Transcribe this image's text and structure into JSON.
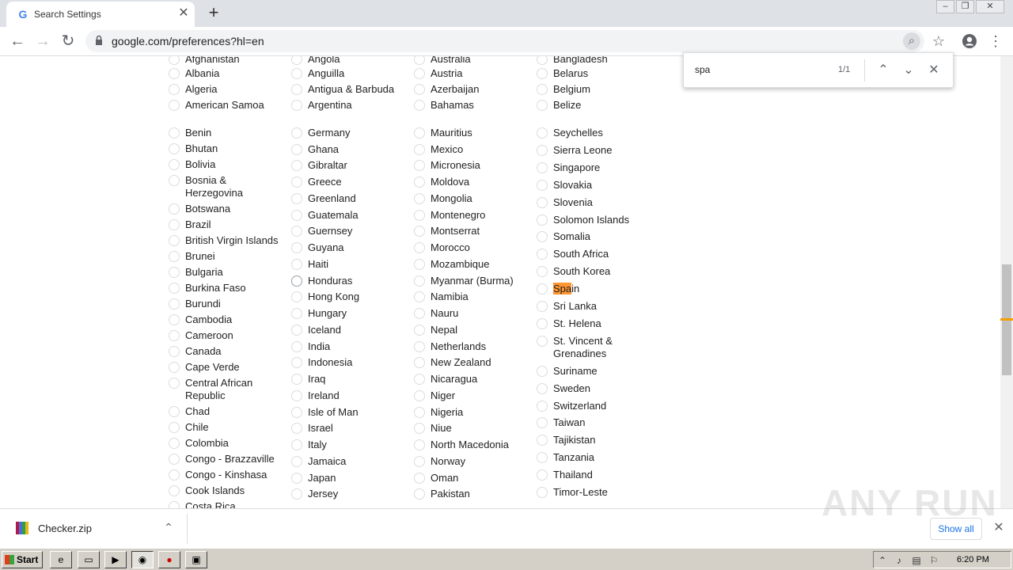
{
  "browser": {
    "tab_title": "Search Settings",
    "tab_favicon": "G",
    "url": "google.com/preferences?hl=en"
  },
  "find": {
    "query": "spa",
    "count": "1/1"
  },
  "columns": [
    [
      "Afghanistan",
      "Albania",
      "Algeria",
      "American Samoa",
      "",
      "Benin",
      "Bhutan",
      "Bolivia",
      "Bosnia & Herzegovina",
      "Botswana",
      "Brazil",
      "British Virgin Islands",
      "Brunei",
      "Bulgaria",
      "Burkina Faso",
      "Burundi",
      "Cambodia",
      "Cameroon",
      "Canada",
      "Cape Verde",
      "Central African Republic",
      "Chad",
      "Chile",
      "Colombia",
      "Congo - Brazzaville",
      "Congo - Kinshasa",
      "Cook Islands",
      "Costa Rica"
    ],
    [
      "Angola",
      "Anguilla",
      "Antigua & Barbuda",
      "Argentina",
      "",
      "Germany",
      "Ghana",
      "Gibraltar",
      "Greece",
      "Greenland",
      "Guatemala",
      "Guernsey",
      "Guyana",
      "Haiti",
      "Honduras",
      "Hong Kong",
      "Hungary",
      "Iceland",
      "India",
      "Indonesia",
      "Iraq",
      "Ireland",
      "Isle of Man",
      "Israel",
      "Italy",
      "Jamaica",
      "Japan",
      "Jersey"
    ],
    [
      "Australia",
      "Austria",
      "Azerbaijan",
      "Bahamas",
      "",
      "Mauritius",
      "Mexico",
      "Micronesia",
      "Moldova",
      "Mongolia",
      "Montenegro",
      "Montserrat",
      "Morocco",
      "Mozambique",
      "Myanmar (Burma)",
      "Namibia",
      "Nauru",
      "Nepal",
      "Netherlands",
      "New Zealand",
      "Nicaragua",
      "Niger",
      "Nigeria",
      "Niue",
      "North Macedonia",
      "Norway",
      "Oman",
      "Pakistan"
    ],
    [
      "Bangladesh",
      "Belarus",
      "Belgium",
      "Belize",
      "",
      "Seychelles",
      "Sierra Leone",
      "Singapore",
      "Slovakia",
      "Slovenia",
      "Solomon Islands",
      "Somalia",
      "South Africa",
      "South Korea",
      "Spain",
      "Sri Lanka",
      "St. Helena",
      "St. Vincent & Grenadines",
      "Suriname",
      "Sweden",
      "Switzerland",
      "Taiwan",
      "Tajikistan",
      "Tanzania",
      "Thailand",
      "Timor-Leste"
    ]
  ],
  "highlight": {
    "country": "Spain",
    "match": "Spa",
    "rest": "in"
  },
  "downloads": {
    "file": "Checker.zip",
    "show_all": "Show all"
  },
  "taskbar": {
    "start": "Start",
    "clock": "6:20 PM"
  },
  "watermark": "ANY RUN"
}
